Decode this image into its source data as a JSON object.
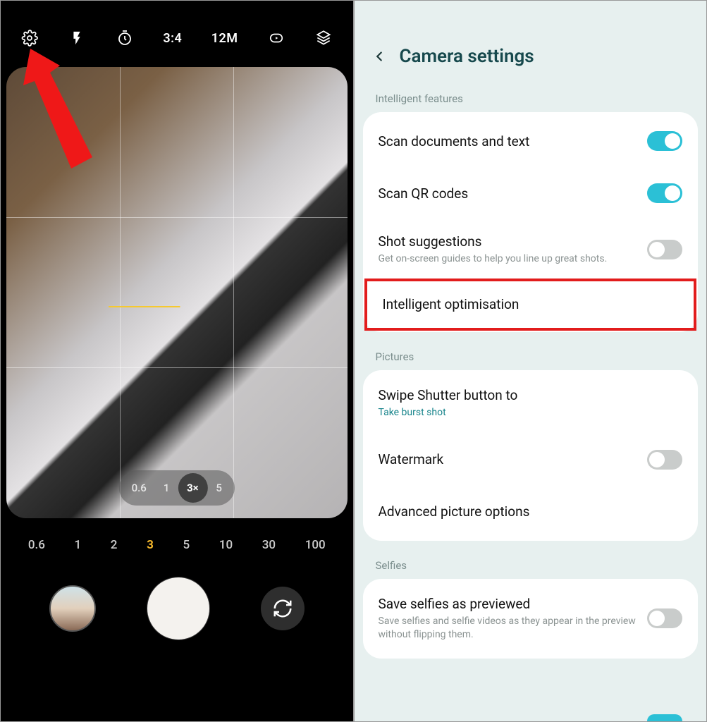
{
  "camera": {
    "topbar": {
      "ratio_label": "3:4",
      "resolution_label": "12M"
    },
    "zoom_pill": [
      "0.6",
      "1",
      "3×",
      "5"
    ],
    "zoom_pill_active_index": 2,
    "zoom_scale": [
      "0.6",
      "1",
      "2",
      "3",
      "5",
      "10",
      "30",
      "100"
    ],
    "zoom_scale_active_index": 3
  },
  "settings": {
    "title": "Camera settings",
    "sections": {
      "intelligent_features": {
        "label": "Intelligent features",
        "items": {
          "scan_docs": {
            "title": "Scan documents and text",
            "toggle": true
          },
          "scan_qr": {
            "title": "Scan QR codes",
            "toggle": true
          },
          "shot_suggestions": {
            "title": "Shot suggestions",
            "sub": "Get on-screen guides to help you line up great shots.",
            "toggle": false
          },
          "intelligent_opt": {
            "title": "Intelligent optimisation"
          }
        }
      },
      "pictures": {
        "label": "Pictures",
        "items": {
          "swipe_shutter": {
            "title": "Swipe Shutter button to",
            "sub": "Take burst shot"
          },
          "watermark": {
            "title": "Watermark",
            "toggle": false
          },
          "advanced": {
            "title": "Advanced picture options"
          }
        }
      },
      "selfies": {
        "label": "Selfies",
        "items": {
          "save_previewed": {
            "title": "Save selfies as previewed",
            "sub": "Save selfies and selfie videos as they appear in the preview without flipping them.",
            "toggle": false
          }
        }
      }
    }
  }
}
